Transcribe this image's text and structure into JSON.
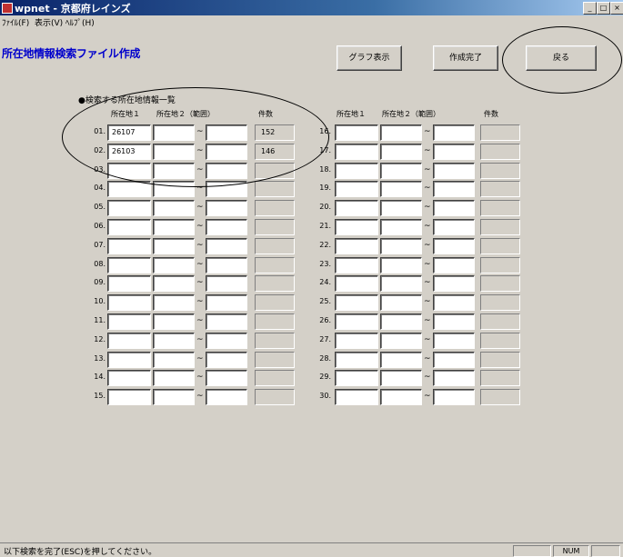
{
  "window": {
    "title": "wpnet - 京都府レインズ",
    "buttons": {
      "minimize": "_",
      "maximize": "□",
      "close": "×"
    }
  },
  "menu": [
    "ﾌｧｲﾙ(F)",
    "表示(V)",
    "ﾍﾙﾌﾟ(H)"
  ],
  "page_title": "所在地情報検索ファイル作成",
  "toolbar": {
    "graph_label": "グラフ表示",
    "done_label": "作成完了",
    "back_label": "戻る"
  },
  "section_title": "●検索する所在地情報一覧",
  "headers": {
    "left": {
      "col1": "所在地１",
      "col2": "所在地２（範囲）",
      "col3": "件数"
    },
    "right": {
      "col1": "所在地１",
      "col2": "所在地２（範囲）",
      "col3": "件数"
    }
  },
  "left_rows": [
    {
      "num": "01.",
      "f1": "26107",
      "f2": "",
      "f3": "",
      "count": "152"
    },
    {
      "num": "02.",
      "f1": "26103",
      "f2": "",
      "f3": "",
      "count": "146"
    },
    {
      "num": "03.",
      "f1": "",
      "f2": "",
      "f3": "",
      "count": ""
    },
    {
      "num": "04.",
      "f1": "",
      "f2": "",
      "f3": "",
      "count": ""
    },
    {
      "num": "05.",
      "f1": "",
      "f2": "",
      "f3": "",
      "count": ""
    },
    {
      "num": "06.",
      "f1": "",
      "f2": "",
      "f3": "",
      "count": ""
    },
    {
      "num": "07.",
      "f1": "",
      "f2": "",
      "f3": "",
      "count": ""
    },
    {
      "num": "08.",
      "f1": "",
      "f2": "",
      "f3": "",
      "count": ""
    },
    {
      "num": "09.",
      "f1": "",
      "f2": "",
      "f3": "",
      "count": ""
    },
    {
      "num": "10.",
      "f1": "",
      "f2": "",
      "f3": "",
      "count": ""
    },
    {
      "num": "11.",
      "f1": "",
      "f2": "",
      "f3": "",
      "count": ""
    },
    {
      "num": "12.",
      "f1": "",
      "f2": "",
      "f3": "",
      "count": ""
    },
    {
      "num": "13.",
      "f1": "",
      "f2": "",
      "f3": "",
      "count": ""
    },
    {
      "num": "14.",
      "f1": "",
      "f2": "",
      "f3": "",
      "count": ""
    },
    {
      "num": "15.",
      "f1": "",
      "f2": "",
      "f3": "",
      "count": ""
    }
  ],
  "right_rows": [
    {
      "num": "16.",
      "f1": "",
      "f2": "",
      "f3": "",
      "count": ""
    },
    {
      "num": "17.",
      "f1": "",
      "f2": "",
      "f3": "",
      "count": ""
    },
    {
      "num": "18.",
      "f1": "",
      "f2": "",
      "f3": "",
      "count": ""
    },
    {
      "num": "19.",
      "f1": "",
      "f2": "",
      "f3": "",
      "count": ""
    },
    {
      "num": "20.",
      "f1": "",
      "f2": "",
      "f3": "",
      "count": ""
    },
    {
      "num": "21.",
      "f1": "",
      "f2": "",
      "f3": "",
      "count": ""
    },
    {
      "num": "22.",
      "f1": "",
      "f2": "",
      "f3": "",
      "count": ""
    },
    {
      "num": "23.",
      "f1": "",
      "f2": "",
      "f3": "",
      "count": ""
    },
    {
      "num": "24.",
      "f1": "",
      "f2": "",
      "f3": "",
      "count": ""
    },
    {
      "num": "25.",
      "f1": "",
      "f2": "",
      "f3": "",
      "count": ""
    },
    {
      "num": "26.",
      "f1": "",
      "f2": "",
      "f3": "",
      "count": ""
    },
    {
      "num": "27.",
      "f1": "",
      "f2": "",
      "f3": "",
      "count": ""
    },
    {
      "num": "28.",
      "f1": "",
      "f2": "",
      "f3": "",
      "count": ""
    },
    {
      "num": "29.",
      "f1": "",
      "f2": "",
      "f3": "",
      "count": ""
    },
    {
      "num": "30.",
      "f1": "",
      "f2": "",
      "f3": "",
      "count": ""
    }
  ],
  "tilde": "~",
  "status": {
    "message": "以下検索を完了(ESC)を押してください。",
    "mode": "NUM"
  }
}
